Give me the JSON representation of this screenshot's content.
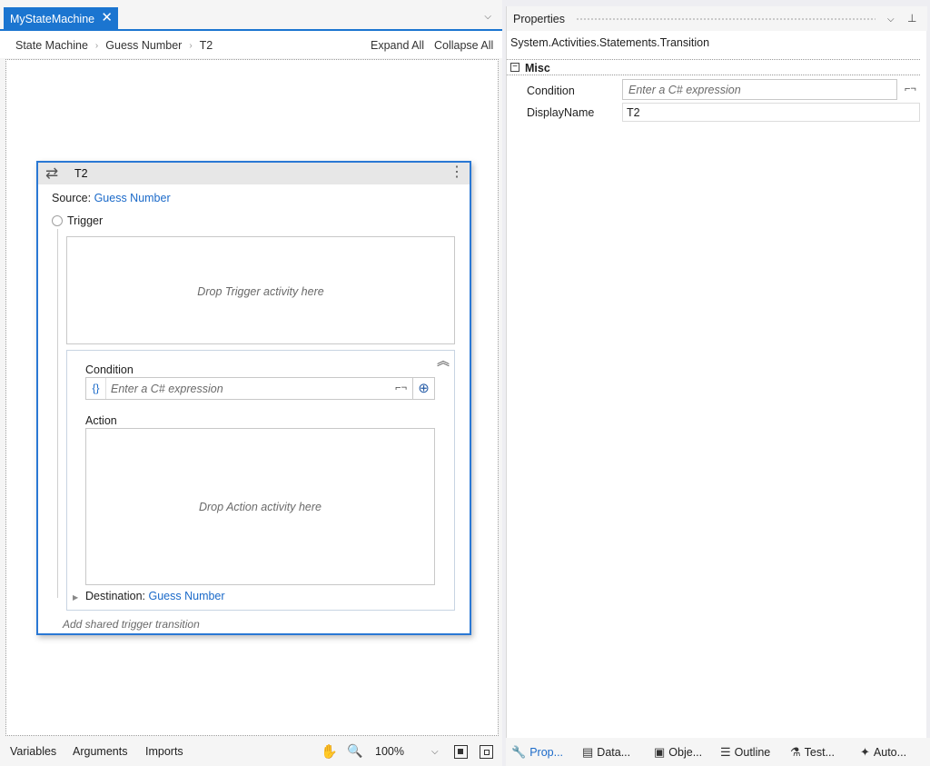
{
  "document": {
    "tab_title": "MyStateMachine",
    "close_glyph": "✕",
    "tab_dropdown_glyph": "⌵"
  },
  "breadcrumb": {
    "items": [
      "State Machine",
      "Guess Number",
      "T2"
    ],
    "separator": "›"
  },
  "toolbar": {
    "expand_all": "Expand All",
    "collapse_all": "Collapse All"
  },
  "transition": {
    "title": "T2",
    "source_label": "Source: ",
    "source_value": "Guess Number",
    "trigger_label": "Trigger",
    "trigger_drop": "Drop Trigger activity here",
    "condition_label": "Condition",
    "condition_placeholder": "Enter a C# expression",
    "braces": "{}",
    "action_label": "Action",
    "action_drop": "Drop Action activity here",
    "destination_label": "Destination: ",
    "destination_value": "Guess Number",
    "shared_trigger": "Add shared trigger transition"
  },
  "bottom_bar": {
    "variables": "Variables",
    "arguments": "Arguments",
    "imports": "Imports",
    "zoom": "100%"
  },
  "properties": {
    "title": "Properties",
    "type_name": "System.Activities.Statements.Transition",
    "category": "Misc",
    "condition_name": "Condition",
    "condition_placeholder": "Enter a C# expression",
    "displayname_name": "DisplayName",
    "displayname_value": "T2"
  },
  "tool_tabs": [
    "Prop...",
    "Data...",
    "Obje...",
    "Outline",
    "Test...",
    "Auto..."
  ],
  "colors": {
    "accent": "#1b75d0",
    "link": "#1b6ac9"
  }
}
